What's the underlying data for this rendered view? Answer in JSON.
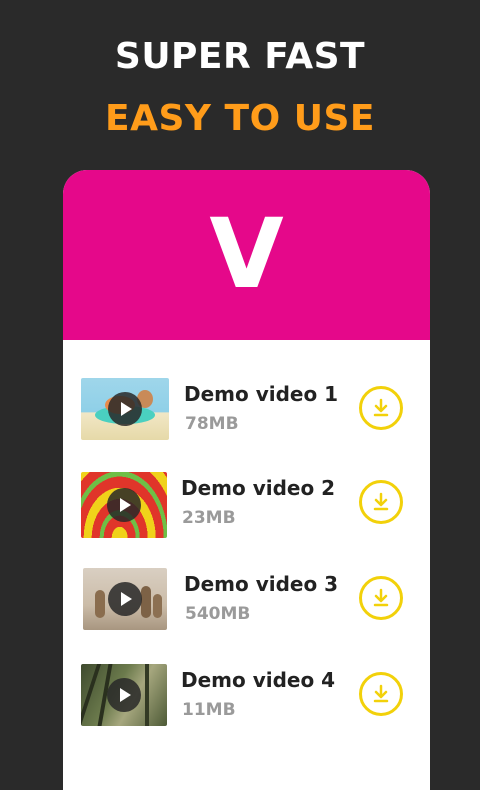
{
  "headline": {
    "line1": "SUPER FAST",
    "line2": "EASY TO USE"
  },
  "app": {
    "logo_letter": "V",
    "brand_color": "#e5088a",
    "accent_color": "#ff9c1a",
    "download_icon_color": "#f2d10a"
  },
  "videos": [
    {
      "title": "Demo video 1",
      "size": "78MB",
      "thumbnail_icon": "pool-float-thumbnail",
      "action_icon": "download-icon"
    },
    {
      "title": "Demo video 2",
      "size": "23MB",
      "thumbnail_icon": "sombrero-thumbnail",
      "action_icon": "download-icon"
    },
    {
      "title": "Demo video 3",
      "size": "540MB",
      "thumbnail_icon": "meerkats-thumbnail",
      "action_icon": "download-icon"
    },
    {
      "title": "Demo video 4",
      "size": "11MB",
      "thumbnail_icon": "forest-thumbnail",
      "action_icon": "download-icon"
    }
  ]
}
